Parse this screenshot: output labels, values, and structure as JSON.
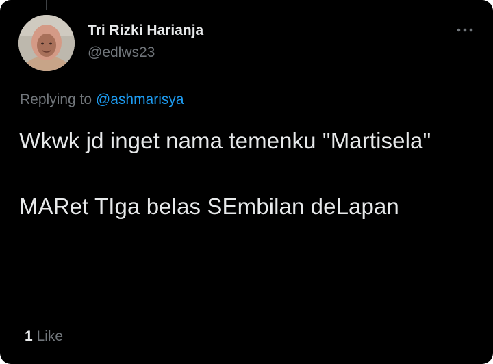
{
  "author": {
    "name": "Tri Rizki Harianja",
    "handle": "@edlws23",
    "avatar_icon": "profile-photo"
  },
  "reply": {
    "prefix": "Replying to ",
    "mention": "@ashmarisya"
  },
  "tweet": {
    "lines": [
      "Wkwk jd inget nama temenku \"Martisela\"",
      "MARet TIga belas SEmbilan deLapan"
    ]
  },
  "stats": {
    "likes_count": "1",
    "likes_label": "Like"
  },
  "icons": {
    "more": "more-dots-icon"
  },
  "colors": {
    "background": "#000000",
    "text_primary": "#e7e9ea",
    "text_secondary": "#71767b",
    "accent": "#1d9bf0",
    "divider": "#2f3336"
  }
}
